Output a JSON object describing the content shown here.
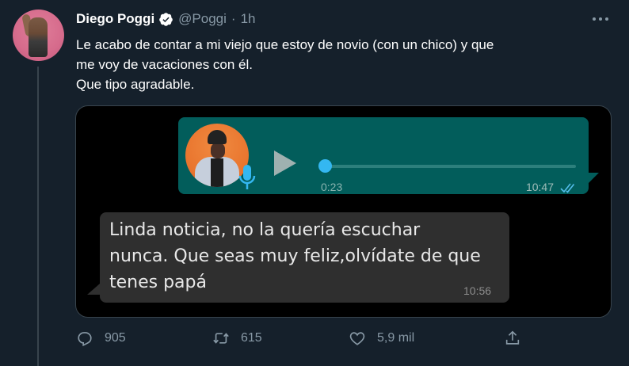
{
  "author": {
    "name": "Diego Poggi",
    "handle": "@Poggi",
    "separator": "·",
    "time": "1h",
    "verified": true
  },
  "tweet": {
    "lines": [
      "Le acabo de contar a mi viejo que estoy de novio (con un chico) y que",
      "me voy de vacaciones con él.",
      "Que tipo agradable."
    ]
  },
  "chat": {
    "voice_note": {
      "duration": "0:23",
      "time": "10:47",
      "progress": 0,
      "status_icon": "double-check-icon"
    },
    "message": {
      "lines": [
        "Linda noticia, no la quería escuchar",
        "nunca. Que seas muy feliz,olvídate de que",
        "tenes papá"
      ],
      "time": "10:56"
    }
  },
  "actions": {
    "replies": "905",
    "retweets": "615",
    "likes": "5,9 mil",
    "share_icon": "share-icon"
  },
  "colors": {
    "background": "#15202b",
    "voice_bubble": "#025d5b",
    "message_bubble": "#2f2f2f",
    "accent": "#34b7f1",
    "muted": "#8899a6"
  }
}
